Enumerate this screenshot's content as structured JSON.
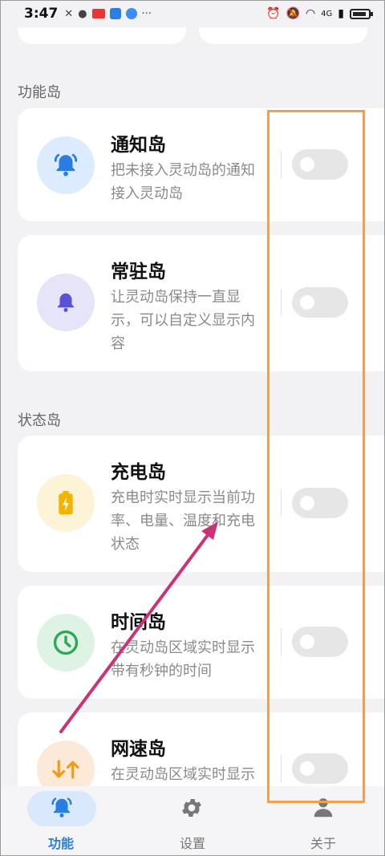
{
  "status_bar": {
    "time": "3:47",
    "more": "···",
    "network": "4G"
  },
  "sections": {
    "function": "功能岛",
    "status": "状态岛"
  },
  "cards": [
    {
      "title": "通知岛",
      "desc": "把未接入灵动岛的通知接入灵动岛",
      "icon": "bell-ringing-icon",
      "icon_bg": "#dcecfe",
      "icon_color": "#2a7de1",
      "enabled": false
    },
    {
      "title": "常驻岛",
      "desc": "让灵动岛保持一直显示，可以自定义显示内容",
      "icon": "bell-icon",
      "icon_bg": "#e6e4f8",
      "icon_color": "#5a52d6",
      "enabled": false
    },
    {
      "title": "充电岛",
      "desc": "充电时实时显示当前功率、电量、温度和充电状态",
      "icon": "battery-charging-icon",
      "icon_bg": "#fdf3d6",
      "icon_color": "#f2b400",
      "enabled": false
    },
    {
      "title": "时间岛",
      "desc": "在灵动岛区域实时显示带有秒钟的时间",
      "icon": "clock-icon",
      "icon_bg": "#dff3e4",
      "icon_color": "#2fa855",
      "enabled": false
    },
    {
      "title": "网速岛",
      "desc": "在灵动岛区域实时显示下载和上传速度",
      "icon": "network-speed-icon",
      "icon_bg": "#fde9d8",
      "icon_color": "#f29a1a",
      "enabled": false
    }
  ],
  "nav": [
    {
      "label": "功能",
      "icon": "bell-icon",
      "active": true
    },
    {
      "label": "设置",
      "icon": "gear-icon",
      "active": false
    },
    {
      "label": "关于",
      "icon": "person-icon",
      "active": false
    }
  ],
  "colors": {
    "accent": "#2a7de1",
    "highlight": "#f0a050",
    "arrow": "#cc3377"
  }
}
